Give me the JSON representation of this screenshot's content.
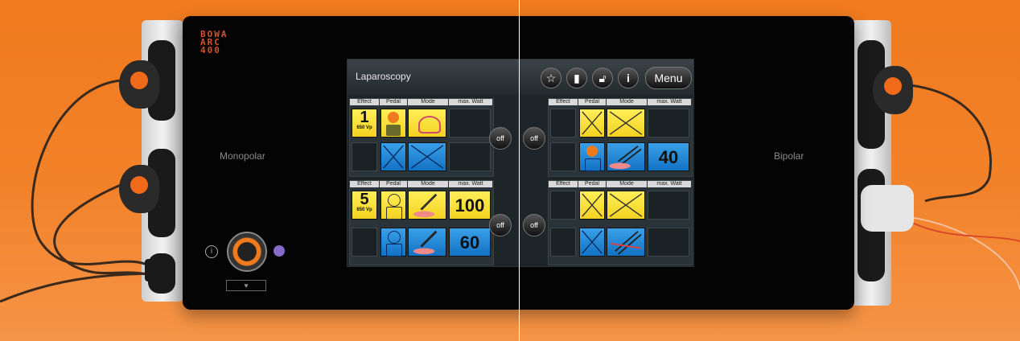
{
  "device": {
    "brand_lines": [
      "BOWA",
      "ARC",
      "400"
    ],
    "left_label": "Monopolar",
    "right_label": "Bipolar",
    "icons": [
      "info-icon",
      "power-knob-icon",
      "purple-button-icon",
      "bf-symbol-icon"
    ]
  },
  "screen": {
    "title": "Laparoscopy",
    "menu_label": "Menu",
    "top_buttons": [
      "star-icon",
      "book-icon",
      "unlock-icon",
      "info-icon"
    ],
    "headers": [
      "Effect",
      "Pedal",
      "Mode",
      "max. Watt"
    ],
    "off_label": "off",
    "monopolar": [
      {
        "effect": "1",
        "effect_sub": "650 Vp",
        "row1_watt": "",
        "row2_watt": ""
      },
      {
        "effect": "5",
        "effect_sub": "650 Vp",
        "row1_watt": "100",
        "row2_watt": "60"
      }
    ],
    "bipolar": [
      {
        "row1_watt": "",
        "row2_watt": "40"
      },
      {
        "row1_watt": "",
        "row2_watt": ""
      }
    ]
  },
  "colors": {
    "background": "#f07a1e",
    "yellow": "#f4d222",
    "blue": "#1272c4",
    "accent": "#d2522a"
  }
}
